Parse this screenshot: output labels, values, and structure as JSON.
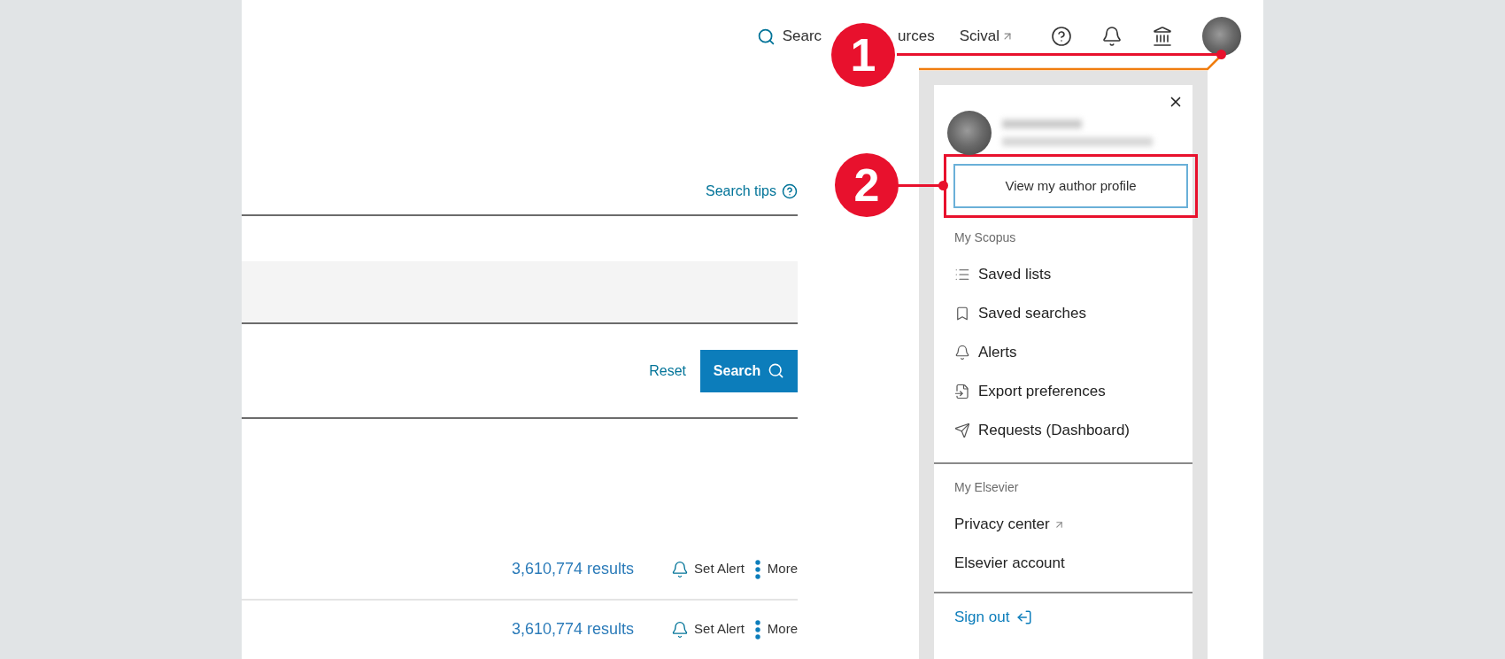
{
  "header": {
    "nav": [
      {
        "kind": "search",
        "text": "Searc"
      },
      {
        "kind": "plain",
        "text": "urces"
      },
      {
        "kind": "external",
        "text": "Scival"
      }
    ]
  },
  "annotations": [
    {
      "label": "1"
    },
    {
      "label": "2"
    }
  ],
  "search_form": {
    "search_tips": "Search tips",
    "reset": "Reset",
    "search_button": "Search"
  },
  "results": [
    {
      "count": "3,610,774 results",
      "alert": "Set Alert",
      "more": "More"
    },
    {
      "count": "3,610,774 results",
      "alert": "Set Alert",
      "more": "More"
    }
  ],
  "account_menu": {
    "primary_button": "View my author profile",
    "sections": [
      {
        "heading": "My Scopus",
        "items": [
          {
            "label": "Saved lists",
            "kind": "list"
          },
          {
            "label": "Saved searches",
            "kind": "bookmark"
          },
          {
            "label": "Alerts",
            "kind": "bell"
          },
          {
            "label": "Export preferences",
            "kind": "export"
          },
          {
            "label": "Requests (Dashboard)",
            "kind": "send"
          }
        ]
      },
      {
        "heading": "My Elsevier",
        "items": [
          {
            "label": "Privacy center",
            "external": true
          },
          {
            "label": "Elsevier account",
            "external": false
          }
        ]
      }
    ],
    "sign_out": "Sign out"
  }
}
